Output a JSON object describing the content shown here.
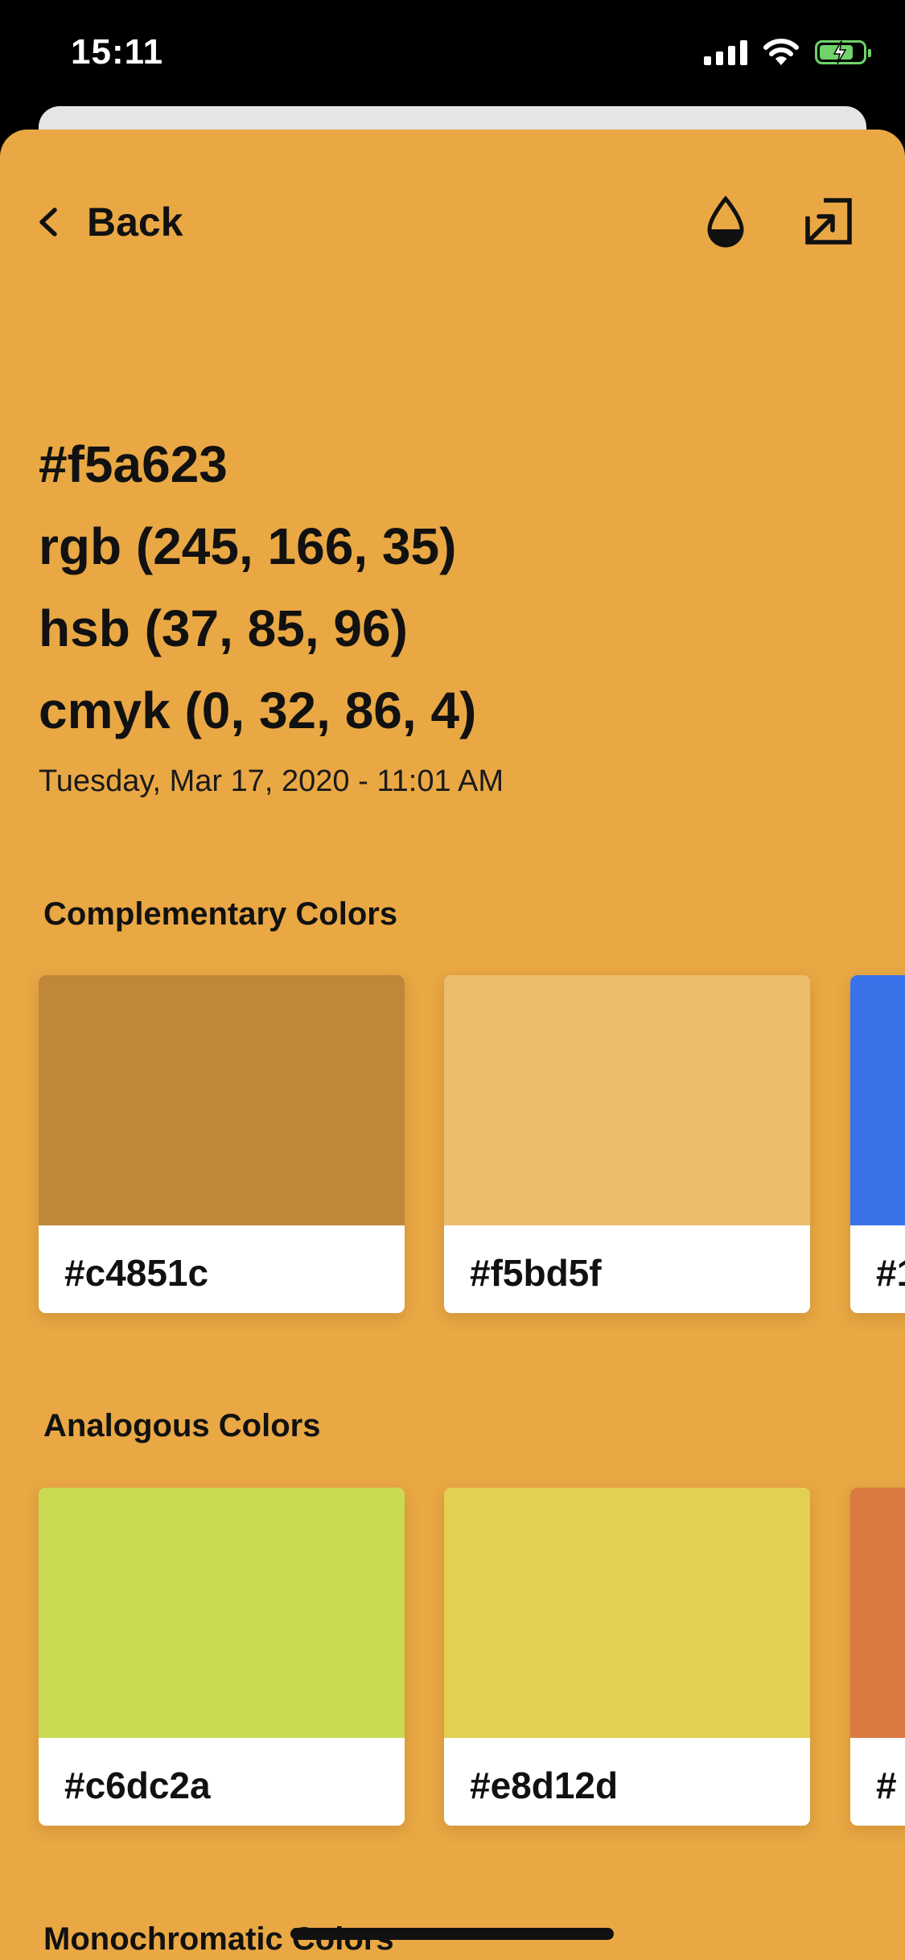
{
  "status_bar": {
    "time": "15:11",
    "battery_color": "#6fd26a"
  },
  "nav": {
    "back_label": "Back",
    "icons": [
      "chevron-left-icon",
      "drop-icon",
      "export-icon"
    ]
  },
  "color": {
    "hex": "#f5a623",
    "rgb": "rgb (245, 166, 35)",
    "hsb": "hsb (37, 85, 96)",
    "cmyk": "cmyk (0, 32, 86, 4)",
    "timestamp": "Tuesday, Mar 17, 2020 - 11:01 AM"
  },
  "sheet_background": "#e9a844",
  "sections": [
    {
      "title": "Complementary Colors",
      "swatches": [
        {
          "label": "#c4851c",
          "color": "#c0873a"
        },
        {
          "label": "#f5bd5f",
          "color": "#ecbd6d"
        },
        {
          "label": "#1",
          "color": "#3a72ea"
        }
      ]
    },
    {
      "title": "Analogous Colors",
      "swatches": [
        {
          "label": "#c6dc2a",
          "color": "#c9db52"
        },
        {
          "label": "#e8d12d",
          "color": "#e3d052"
        },
        {
          "label": "#",
          "color": "#db7a40"
        }
      ]
    },
    {
      "title": "Monochromatic Colors",
      "swatches": []
    }
  ]
}
